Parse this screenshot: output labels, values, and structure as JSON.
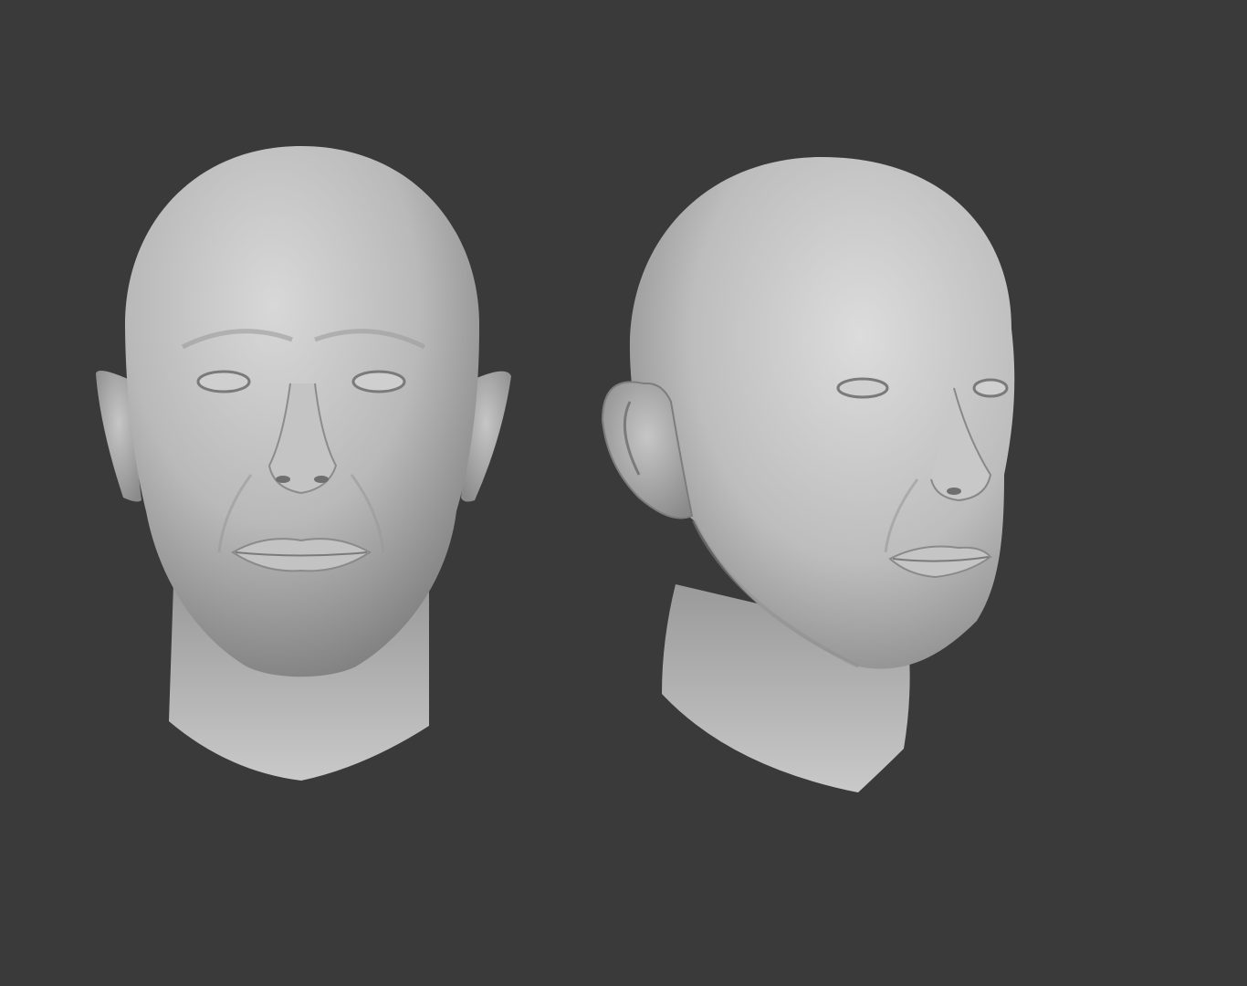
{
  "scene": {
    "background_color": "#3a3a3a",
    "material_color": "#bdbdbd",
    "models": [
      {
        "view": "front",
        "icon": "head-sculpt-front"
      },
      {
        "view": "three-quarter",
        "icon": "head-sculpt-three-quarter"
      }
    ]
  }
}
